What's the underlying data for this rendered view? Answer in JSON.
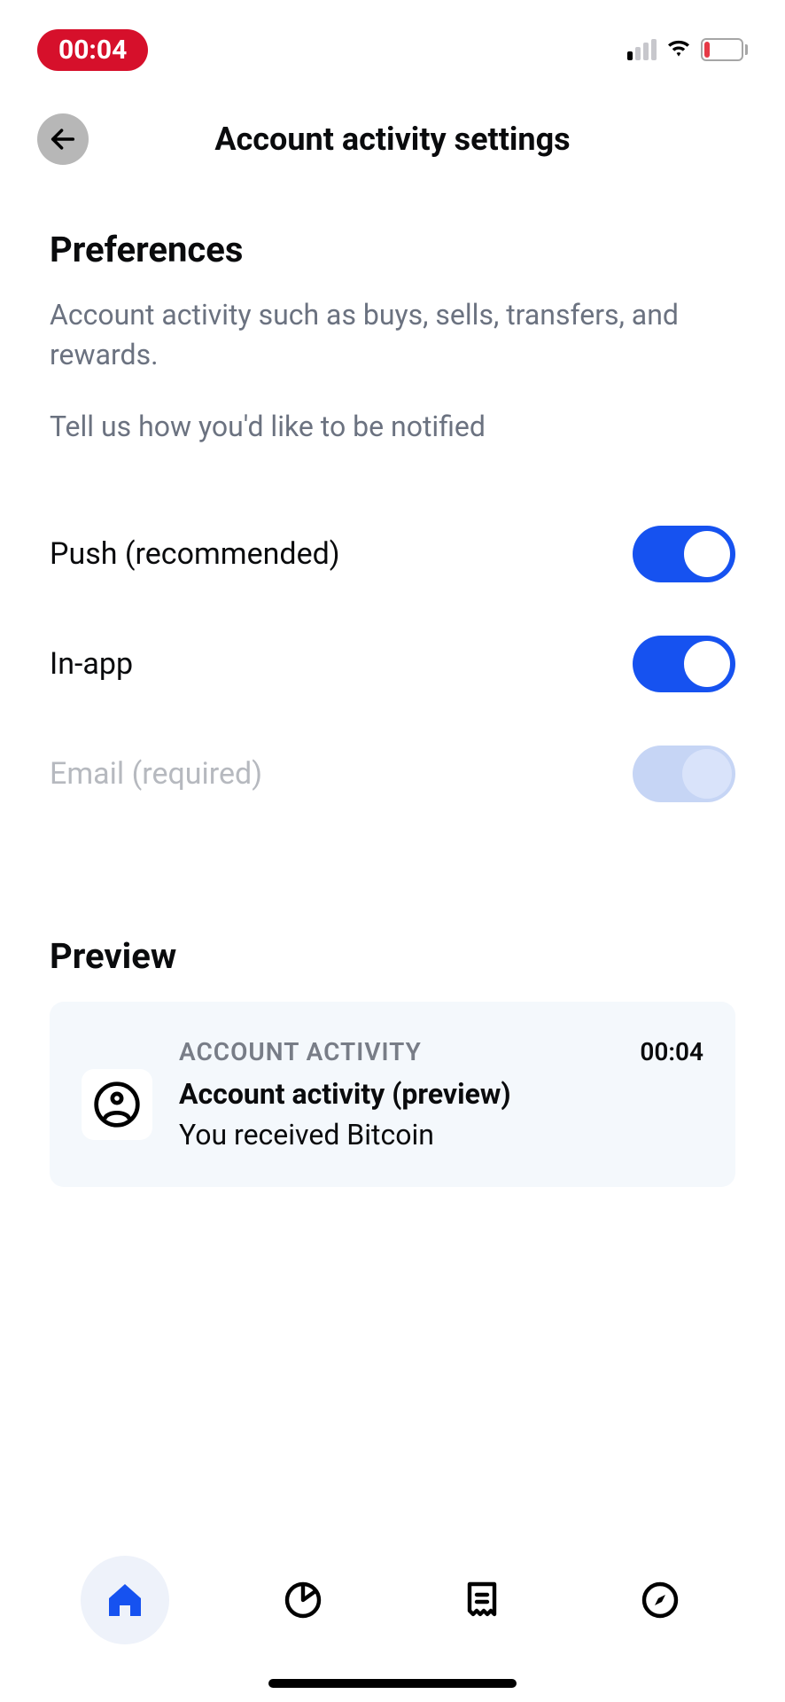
{
  "status": {
    "time": "00:04",
    "battery": "13"
  },
  "header": {
    "title": "Account activity settings"
  },
  "preferences": {
    "heading": "Preferences",
    "description": "Account activity such as buys, sells, transfers, and rewards.",
    "prompt": "Tell us how you'd like to be notified",
    "items": [
      {
        "label": "Push (recommended)",
        "on": true,
        "disabled": false
      },
      {
        "label": "In-app",
        "on": true,
        "disabled": false
      },
      {
        "label": "Email (required)",
        "on": true,
        "disabled": true
      }
    ]
  },
  "preview": {
    "heading": "Preview",
    "category": "ACCOUNT ACTIVITY",
    "time": "00:04",
    "title": "Account activity (preview)",
    "message": "You received Bitcoin"
  }
}
